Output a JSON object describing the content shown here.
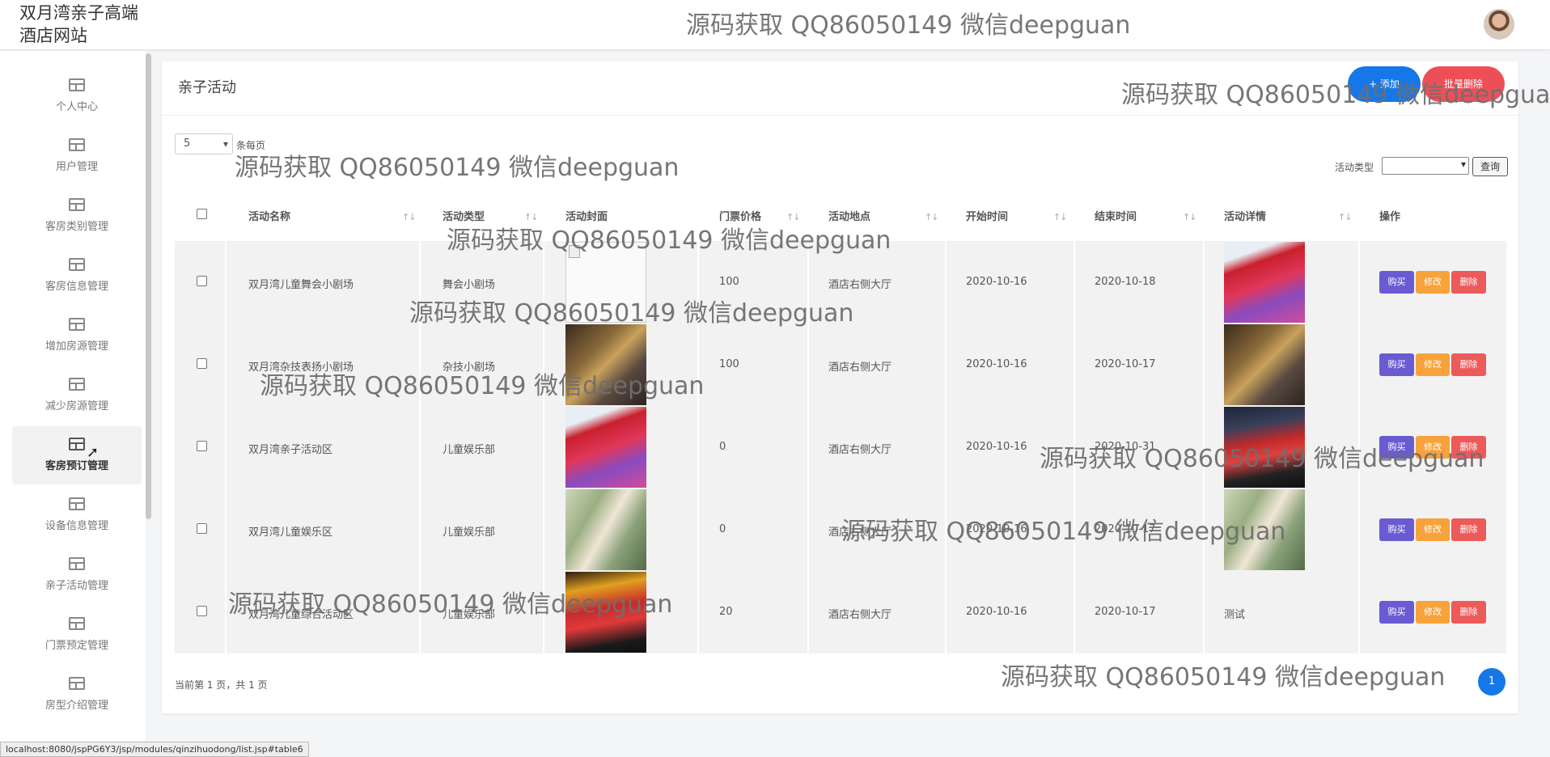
{
  "header": {
    "site_title": "双月湾亲子高端酒店网站",
    "watermark": "源码获取 QQ86050149 微信deepguan"
  },
  "sidebar": {
    "items": [
      {
        "label": "个人中心",
        "active": false
      },
      {
        "label": "用户管理",
        "active": false
      },
      {
        "label": "客房类别管理",
        "active": false
      },
      {
        "label": "客房信息管理",
        "active": false
      },
      {
        "label": "增加房源管理",
        "active": false
      },
      {
        "label": "减少房源管理",
        "active": false
      },
      {
        "label": "客房预订管理",
        "active": true
      },
      {
        "label": "设备信息管理",
        "active": false
      },
      {
        "label": "亲子活动管理",
        "active": false
      },
      {
        "label": "门票预定管理",
        "active": false
      },
      {
        "label": "房型介绍管理",
        "active": false
      }
    ]
  },
  "status_bar": "localhost:8080/jspPG6Y3/jsp/modules/qinzihuodong/list.jsp#table6",
  "panel": {
    "title": "亲子活动",
    "add_label": "+ 添加",
    "batch_delete_label": "批量删除",
    "page_size": "5",
    "page_size_label": "条每页",
    "filter_label": "活动类型",
    "filter_value": "",
    "query_label": "查询",
    "page_info": "当前第 1 页，共 1 页",
    "current_page": "1"
  },
  "table": {
    "columns": [
      "活动名称",
      "活动类型",
      "活动封面",
      "门票价格",
      "活动地点",
      "开始时间",
      "结束时间",
      "活动详情",
      "操作"
    ],
    "actions": {
      "buy": "购买",
      "edit": "修改",
      "delete": "删除"
    },
    "rows": [
      {
        "name": "双月湾儿童舞会小剧场",
        "type": "舞会小剧场",
        "cover": "broken-image",
        "price": "100",
        "location": "酒店右侧大厅",
        "start": "2020-10-16",
        "end": "2020-10-18",
        "detail": "",
        "detail_image": "kids-costume-photo"
      },
      {
        "name": "双月湾杂技表扬小剧场",
        "type": "杂技小剧场",
        "cover": "stage-photo",
        "price": "100",
        "location": "酒店右侧大厅",
        "start": "2020-10-16",
        "end": "2020-10-17",
        "detail": "",
        "detail_image": "stage-photo"
      },
      {
        "name": "双月湾亲子活动区",
        "type": "儿童娱乐部",
        "cover": "kids-costume-photo",
        "price": "0",
        "location": "酒店右侧大厅",
        "start": "2020-10-16",
        "end": "2020-10-31",
        "detail": "",
        "detail_image": "girl-costume-photo"
      },
      {
        "name": "双月湾儿童娱乐区",
        "type": "儿童娱乐部",
        "cover": "playroom-photo",
        "price": "0",
        "location": "酒店右侧大厅",
        "start": "2020-10-16",
        "end": "2020-10-17",
        "detail": "",
        "detail_image": "playroom-photo"
      },
      {
        "name": "双月湾儿童综合活动区",
        "type": "儿童娱乐部",
        "cover": "girl-costume-photo",
        "price": "20",
        "location": "酒店右侧大厅",
        "start": "2020-10-16",
        "end": "2020-10-17",
        "detail": "测试",
        "detail_image": ""
      }
    ]
  }
}
